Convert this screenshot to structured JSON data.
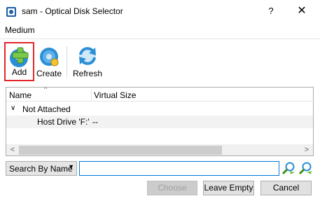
{
  "window": {
    "title": "sam - Optical Disk Selector",
    "help_label": "?",
    "close_label": "✕"
  },
  "menu": {
    "medium_label": "Medium"
  },
  "toolbar": {
    "add_label": "Add",
    "create_label": "Create",
    "refresh_label": "Refresh"
  },
  "tree": {
    "columns": [
      "Name",
      "Virtual Size"
    ],
    "sort_indicator": "^",
    "group": {
      "expander": "∨",
      "label": "Not Attached"
    },
    "rows": [
      {
        "name": "Host Drive 'F:'",
        "virtual_size": "--"
      }
    ]
  },
  "scrollbar": {
    "left_arrow": "<",
    "right_arrow": ">"
  },
  "search": {
    "mode_label": "Search By Name",
    "dropdown_arrow": "▼",
    "value": ""
  },
  "buttons": {
    "choose_label": "Choose",
    "leave_empty_label": "Leave Empty",
    "cancel_label": "Cancel"
  },
  "colors": {
    "highlight_border": "#e2262b",
    "search_border": "#0078d7",
    "icon_blue": "#2b8fd6",
    "icon_green": "#7cc84a"
  }
}
